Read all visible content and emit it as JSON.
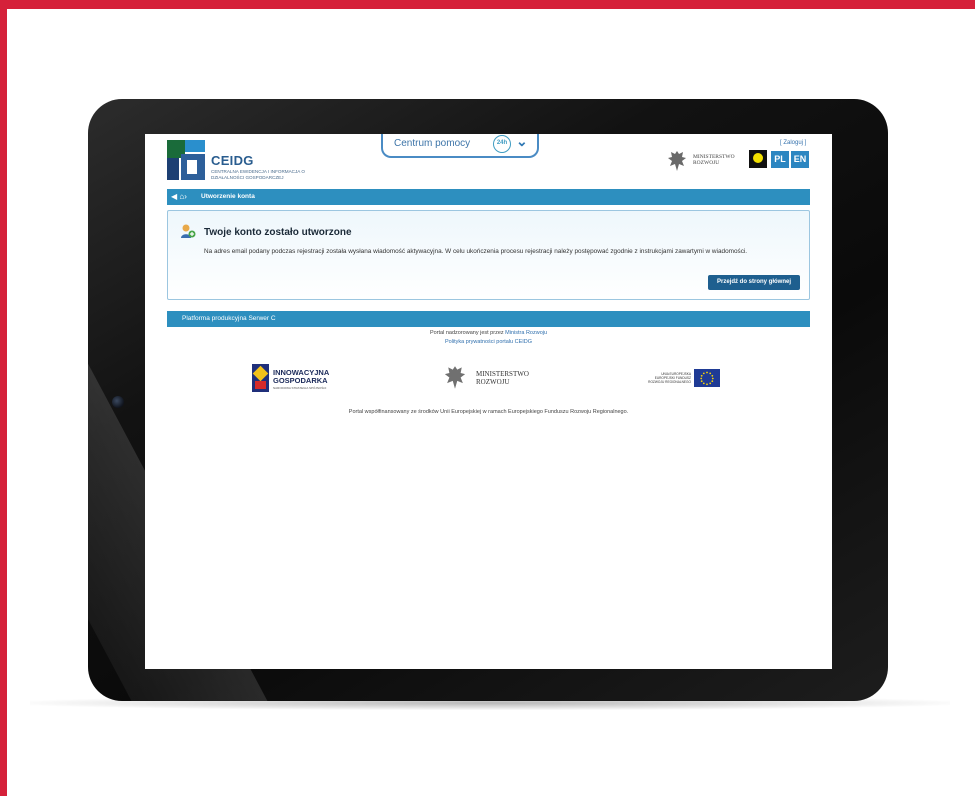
{
  "header": {
    "logo_title": "CEIDG",
    "logo_subtitle": "CENTRALNA EWIDENCJA I INFORMACJA O DZIAŁALNOŚCI GOSPODARCZEJ",
    "help_label": "Centrum pomocy",
    "help_badge": "24h",
    "login_link": "[ Zaloguj ]",
    "ministry_line1": "MINISTERSTWO",
    "ministry_line2": "ROZWOJU",
    "lang_pl": "PL",
    "lang_en": "EN"
  },
  "nav": {
    "breadcrumb_label": "Utworzenie konta"
  },
  "message": {
    "title": "Twoje konto zostało utworzone",
    "text": "Na adres email podany podczas rejestracji została wysłana wiadomość aktywacyjna. W celu ukończenia procesu rejestracji należy postępować zgodnie z instrukcjami zawartymi w wiadomości.",
    "button_label": "Przejdź do strony głównej"
  },
  "platform": {
    "label": "Platforma produkcyjna Serwer C"
  },
  "footer": {
    "supervised_prefix": "Portal nadzorowany jest przez ",
    "supervised_link": "Ministra Rozwoju",
    "privacy_link": "Polityka prywatności portalu CEIDG",
    "cofund_text": "Portal współfinansowany ze środków Unii Europejskiej w ramach Europejskiego Funduszu Rozwoju Regionalnego."
  },
  "sponsors": {
    "ig_line1": "INNOWACYJNA",
    "ig_line2": "GOSPODARKA",
    "ig_sub": "NARODOWA STRATEGIA SPÓJNOŚCI",
    "mr_line1": "MINISTERSTWO",
    "mr_line2": "ROZWOJU",
    "ue_text": "UNIA EUROPEJSKA EUROPEJSKI FUNDUSZ ROZWOJU REGIONALNEGO"
  },
  "colors": {
    "frame_red": "#d5213a",
    "nav_blue": "#2d8fbf",
    "button_blue": "#1e5f8f"
  }
}
